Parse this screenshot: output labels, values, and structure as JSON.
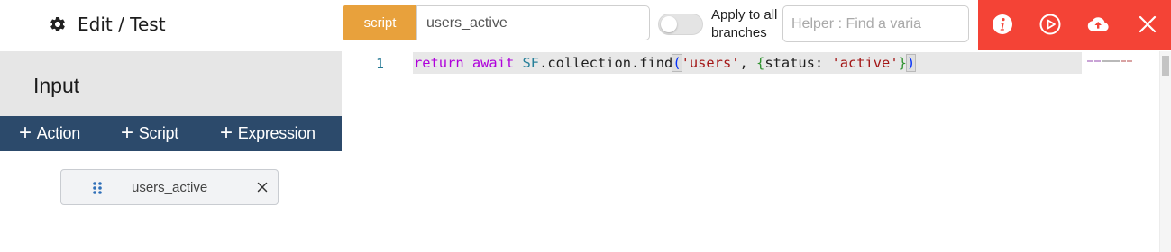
{
  "header": {
    "title": "Edit / Test",
    "script_button": "script",
    "name_value": "users_active",
    "apply_label": "Apply to all branches",
    "apply_enabled": false,
    "helper_placeholder": "Helper : Find a varia",
    "action_icons": [
      "info-icon",
      "play-icon",
      "cloud-upload-icon",
      "close-icon"
    ],
    "colors": {
      "script_button": "#e8a13c",
      "action_bar": "#f44336",
      "add_bar": "#2c4a6b"
    }
  },
  "left_panel": {
    "section_title": "Input",
    "add_buttons": [
      {
        "plus": "+",
        "label": "Action"
      },
      {
        "plus": "+",
        "label": "Script"
      },
      {
        "plus": "+",
        "label": "Expression"
      }
    ],
    "input_chip": {
      "label": "users_active"
    }
  },
  "editor": {
    "line_number": "1",
    "code": {
      "kw_return": "return",
      "kw_await": "await",
      "object": "SF",
      "call": ".collection.find",
      "open_paren": "(",
      "arg1": "'users'",
      "comma": ", ",
      "open_brace": "{",
      "key": "status: ",
      "arg2": "'active'",
      "close_brace": "}",
      "close_paren": ")"
    }
  }
}
